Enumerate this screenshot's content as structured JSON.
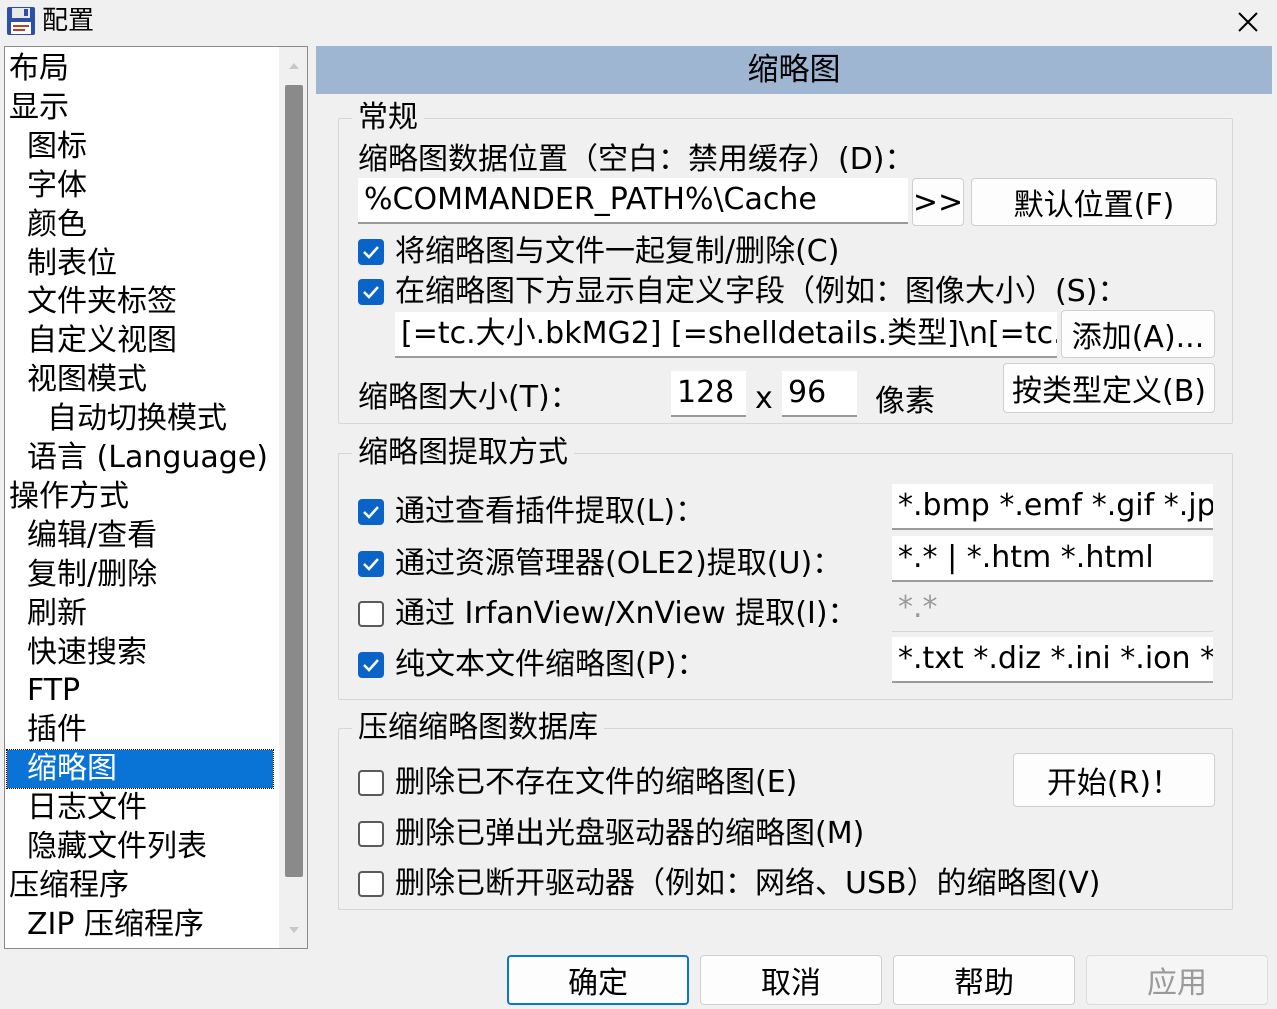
{
  "window": {
    "title": "配置",
    "close_glyph": "✕"
  },
  "tree": {
    "items": [
      {
        "label": "布局",
        "level": 0
      },
      {
        "label": "显示",
        "level": 0
      },
      {
        "label": "图标",
        "level": 1
      },
      {
        "label": "字体",
        "level": 1
      },
      {
        "label": "颜色",
        "level": 1
      },
      {
        "label": "制表位",
        "level": 1
      },
      {
        "label": "文件夹标签",
        "level": 1
      },
      {
        "label": "自定义视图",
        "level": 1
      },
      {
        "label": "视图模式",
        "level": 1
      },
      {
        "label": "自动切换模式",
        "level": 2
      },
      {
        "label": "语言 (Language)",
        "level": 1
      },
      {
        "label": "操作方式",
        "level": 0
      },
      {
        "label": "编辑/查看",
        "level": 1
      },
      {
        "label": "复制/删除",
        "level": 1
      },
      {
        "label": "刷新",
        "level": 1
      },
      {
        "label": "快速搜索",
        "level": 1
      },
      {
        "label": "FTP",
        "level": 1
      },
      {
        "label": "插件",
        "level": 1
      },
      {
        "label": "缩略图",
        "level": 1,
        "selected": true
      },
      {
        "label": "日志文件",
        "level": 1
      },
      {
        "label": "隐藏文件列表",
        "level": 1
      },
      {
        "label": "压缩程序",
        "level": 0
      },
      {
        "label": "ZIP 压缩程序",
        "level": 1
      }
    ]
  },
  "panel": {
    "header": "缩略图",
    "general": {
      "title": "常规",
      "location_label": "缩略图数据位置（空白：禁用缓存）(D)：",
      "location_value": "%COMMANDER_PATH%\\Cache",
      "browse_label": ">>",
      "default_location_label": "默认位置(F)",
      "copy_delete_label": "将缩略图与文件一起复制/删除(C)",
      "copy_delete_checked": true,
      "custom_field_label": "在缩略图下方显示自定义字段（例如：图像大小）(S)：",
      "custom_field_checked": true,
      "custom_field_value": "[=tc.大小.bkMG2] [=shelldetails.类型]\\n[=tc.",
      "add_label": "添加(A)...",
      "size_label": "缩略图大小(T)：",
      "width": "128",
      "x_label": "x",
      "height": "96",
      "pixels_label": "像素",
      "by_type_label": "按类型定义(B)"
    },
    "extract": {
      "title": "缩略图提取方式",
      "rows": [
        {
          "label": "通过查看插件提取(L)：",
          "checked": true,
          "value": "*.bmp *.emf *.gif *.jpg",
          "disabled": false
        },
        {
          "label": "通过资源管理器(OLE2)提取(U)：",
          "checked": true,
          "value": "*.* | *.htm *.html",
          "disabled": false
        },
        {
          "label": "通过 IrfanView/XnView 提取(I)：",
          "checked": false,
          "value": "*.*",
          "disabled": true
        },
        {
          "label": "纯文本文件缩略图(P)：",
          "checked": true,
          "value": "*.txt *.diz *.ini *.ion *.bat",
          "disabled": false
        }
      ]
    },
    "compress": {
      "title": "压缩缩略图数据库",
      "start_label": "开始(R)！",
      "rows": [
        {
          "label": "删除已不存在文件的缩略图(E)",
          "checked": false
        },
        {
          "label": "删除已弹出光盘驱动器的缩略图(M)",
          "checked": false
        },
        {
          "label": "删除已断开驱动器（例如：网络、USB）的缩略图(V)",
          "checked": false
        }
      ]
    }
  },
  "footer": {
    "ok_label": "确定",
    "cancel_label": "取消",
    "help_label": "帮助",
    "apply_label": "应用"
  },
  "colors": {
    "accent": "#0a74d6",
    "header": "#9fb6d2",
    "checkbox": "#0a64c8"
  }
}
